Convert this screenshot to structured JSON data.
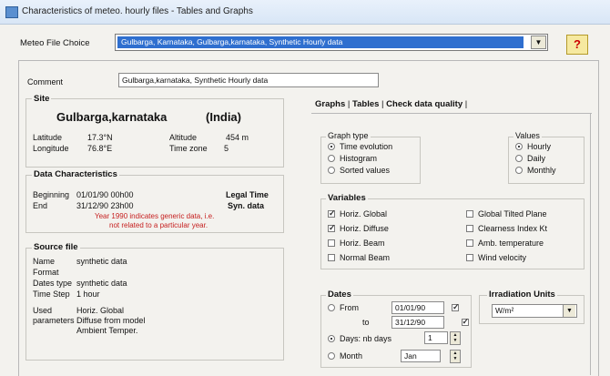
{
  "window": {
    "title": "Characteristics of meteo. hourly files - Tables and Graphs"
  },
  "meteo_choice": {
    "label": "Meteo File Choice",
    "selected": "Gulbarga, Karnataka, Gulbarga,karnataka, Synthetic Hourly data",
    "help_label": "?"
  },
  "comment": {
    "label": "Comment",
    "value": "Gulbarga,karnataka, Synthetic Hourly data"
  },
  "site": {
    "group_title": "Site",
    "name": "Gulbarga,karnataka",
    "country": "(India)",
    "latitude_label": "Latitude",
    "latitude_value": "17.3°N",
    "longitude_label": "Longitude",
    "longitude_value": "76.8°E",
    "altitude_label": "Altitude",
    "altitude_value": "454 m",
    "timezone_label": "Time zone",
    "timezone_value": "5"
  },
  "data_characteristics": {
    "group_title": "Data Characteristics",
    "beginning_label": "Beginning",
    "beginning_value": "01/01/90 00h00",
    "end_label": "End",
    "end_value": "31/12/90 23h00",
    "legal_time": "Legal Time",
    "syn_data": "Syn. data",
    "note_line1": "Year 1990 indicates generic data, i.e.",
    "note_line2": "not related to a particular year."
  },
  "source_file": {
    "group_title": "Source file",
    "name_label": "Name",
    "name_value": "synthetic data",
    "format_label": "Format",
    "format_value": "",
    "dates_type_label": "Dates type",
    "dates_type_value": "synthetic data",
    "time_step_label": "Time Step",
    "time_step_value": "1 hour",
    "used_label": "Used",
    "parameters_label": "parameters",
    "param1": "Horiz. Global",
    "param2": "Diffuse from model",
    "param3": "Ambient Temper."
  },
  "tabs": {
    "graphs": "Graphs",
    "tables": "Tables",
    "check": "Check data quality"
  },
  "graph_type": {
    "title": "Graph type",
    "options": [
      "Time evolution",
      "Histogram",
      "Sorted values"
    ],
    "selected_index": 0
  },
  "values": {
    "title": "Values",
    "options": [
      "Hourly",
      "Daily",
      "Monthly"
    ],
    "selected_index": 0
  },
  "variables": {
    "title": "Variables",
    "left": [
      {
        "label": "Horiz. Global",
        "checked": true
      },
      {
        "label": "Horiz. Diffuse",
        "checked": true
      },
      {
        "label": "Horiz. Beam",
        "checked": false
      },
      {
        "label": "Normal Beam",
        "checked": false
      }
    ],
    "right": [
      {
        "label": "Global Tilted Plane",
        "checked": false
      },
      {
        "label": "Clearness Index Kt",
        "checked": false
      },
      {
        "label": "Amb. temperature",
        "checked": false
      },
      {
        "label": "Wind velocity",
        "checked": false
      }
    ]
  },
  "dates": {
    "title": "Dates",
    "from_label": "From",
    "from_value": "01/01/90",
    "to_label": "to",
    "to_value": "31/12/90",
    "days_label": "Days: nb days",
    "days_value": "1",
    "month_label": "Month",
    "month_value": "Jan",
    "selected": "days"
  },
  "irradiation_units": {
    "title": "Irradiation Units",
    "value": "W/m²"
  }
}
